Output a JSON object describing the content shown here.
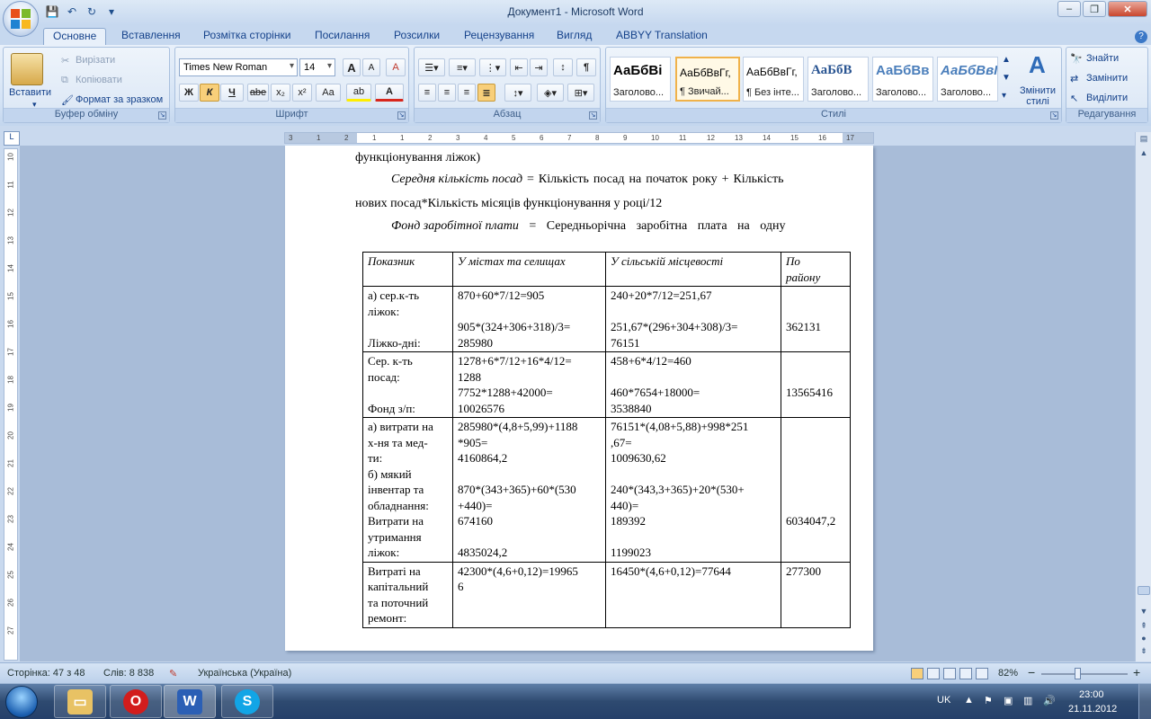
{
  "window": {
    "title": "Документ1 - Microsoft Word",
    "controls": {
      "minimize": "–",
      "restore": "❐",
      "close": "✕"
    }
  },
  "quick_access": [
    "save-icon",
    "undo-icon",
    "redo-icon",
    "customize-icon"
  ],
  "tabs": [
    "Основне",
    "Вставлення",
    "Розмітка сторінки",
    "Посилання",
    "Розсилки",
    "Рецензування",
    "Вигляд",
    "ABBYY Translation"
  ],
  "ribbon": {
    "clipboard": {
      "title": "Буфер обміну",
      "paste": "Вставити",
      "cut": "Вирізати",
      "copy": "Копіювати",
      "format_painter": "Формат за зразком"
    },
    "font": {
      "title": "Шрифт",
      "font_name": "Times New Roman",
      "font_size": "14",
      "bold": "Ж",
      "italic": "К",
      "underline": "Ч",
      "strike": "abe",
      "subscript": "x₂",
      "superscript": "x²",
      "case": "Aa",
      "grow": "A",
      "shrink": "A",
      "clear": "A",
      "highlight": "ab",
      "color": "A"
    },
    "paragraph": {
      "title": "Абзац"
    },
    "styles": {
      "title": "Стилі",
      "items": [
        {
          "sample": "АаБбВі",
          "name": "Заголово..."
        },
        {
          "sample": "АаБбВвГг,",
          "name": "¶ Звичай..."
        },
        {
          "sample": "АаБбВвГг,",
          "name": "¶ Без інте..."
        },
        {
          "sample": "АаБбВ",
          "name": "Заголово..."
        },
        {
          "sample": "АаБбВв",
          "name": "Заголово..."
        },
        {
          "sample": "АаБбВвІ",
          "name": "Заголово..."
        }
      ],
      "change": "Змінити стилі"
    },
    "editing": {
      "title": "Редагування",
      "find": "Знайти",
      "replace": "Замінити",
      "select": "Виділити"
    }
  },
  "ruler": {
    "top_labels": [
      "3",
      "1",
      "2",
      "1",
      "1",
      "2",
      "3",
      "4",
      "5",
      "6",
      "7",
      "8",
      "9",
      "10",
      "11",
      "12",
      "13",
      "14",
      "15",
      "16",
      "17"
    ],
    "left_labels": [
      "10",
      "11",
      "12",
      "13",
      "14",
      "15",
      "16",
      "17",
      "18",
      "19",
      "20",
      "21",
      "22",
      "23",
      "24",
      "25",
      "26",
      "27"
    ]
  },
  "document": {
    "line1": "функціонування ліжок)",
    "p2_italic": "Середня кількість посад",
    "p2_rest": " = Кількість посад на початок року + Кількість",
    "p2_line2": "нових посад*Кількість місяців функціонування у році/12",
    "p3_italic": "Фонд заробітної плати",
    "p3_rest": " = Середньорічна заробітна плата на одну",
    "table": {
      "headers": [
        "Показник",
        "У містах та селищах",
        "У сільській місцевості",
        " По\nрайону"
      ],
      "rows": [
        [
          "а) сер.к-ть\nліжок:\n\nЛіжко-дні:",
          "870+60*7/12=905\n\n905*(324+306+318)/3=\n285980",
          "240+20*7/12=251,67\n\n251,67*(296+304+308)/3=\n76151",
          "\n\n362131"
        ],
        [
          "Сер. к-ть\nпосад:\n\nФонд з/п:",
          "1278+6*7/12+16*4/12=\n1288\n7752*1288+42000=\n10026576",
          "458+6*4/12=460\n\n460*7654+18000=\n3538840",
          "\n\n13565416"
        ],
        [
          "а) витрати на\nх-ня та мед-\nти:\nб) мякий\nінвентар та\nобладнання:\nВитрати на\nутримання\nліжок:",
          "285980*(4,8+5,99)+1188\n*905=\n4160864,2\n\n870*(343+365)+60*(530\n+440)=\n674160\n\n4835024,2",
          "76151*(4,08+5,88)+998*251\n,67=\n1009630,62\n\n240*(343,3+365)+20*(530+\n440)=\n189392\n\n1199023",
          "\n\n\n\n\n\n6034047,2"
        ],
        [
          "Витраті на\nкапітальний\nта поточний\nремонт:",
          "42300*(4,6+0,12)=19965\n6",
          "16450*(4,6+0,12)=77644",
          "277300"
        ]
      ]
    }
  },
  "status": {
    "page": "Сторінка: 47 з 48",
    "words": "Слів: 8 838",
    "language": "Українська (Україна)",
    "zoom": "82%",
    "zoom_minus": "−",
    "zoom_plus": "+"
  },
  "taskbar": {
    "apps": [
      "explorer-icon",
      "opera-icon",
      "word-icon",
      "skype-icon"
    ],
    "lang": "UK",
    "time": "23:00",
    "date": "21.11.2012"
  }
}
